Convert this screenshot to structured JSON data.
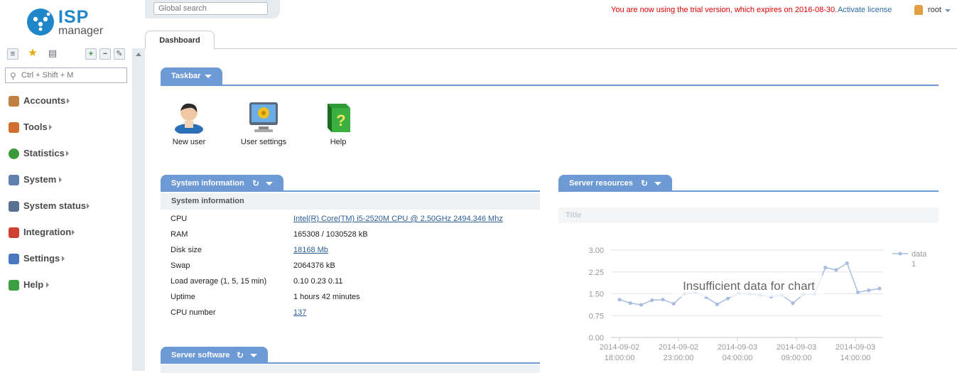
{
  "logo": {
    "word1": "ISP",
    "word2": "manager"
  },
  "nav_search": {
    "placeholder": "Ctrl + Shift + M"
  },
  "nav": [
    {
      "label": "Accounts",
      "icon": "accounts-icon",
      "color": "#c08040"
    },
    {
      "label": "Tools",
      "icon": "tools-icon",
      "color": "#d07030"
    },
    {
      "label": "Statistics",
      "icon": "statistics-icon",
      "color": "#3a9a3a"
    },
    {
      "label": "System",
      "icon": "system-icon",
      "color": "#6080b0"
    },
    {
      "label": "System status",
      "icon": "system-status-icon",
      "color": "#5a7090"
    },
    {
      "label": "Integration",
      "icon": "integration-icon",
      "color": "#d04030"
    },
    {
      "label": "Settings",
      "icon": "settings-icon",
      "color": "#4a78c0"
    },
    {
      "label": "Help",
      "icon": "help-icon",
      "color": "#3aa040"
    }
  ],
  "header": {
    "global_search_placeholder": "Global search",
    "trial_text": "You are now using the trial version, which expires on 2016-08-30.",
    "activate_label": "Activate license",
    "user": "root"
  },
  "tabs": {
    "dashboard": "Dashboard"
  },
  "taskbar": {
    "title": "Taskbar",
    "items": [
      {
        "label": "New user",
        "icon": "new-user-icon"
      },
      {
        "label": "User settings",
        "icon": "user-settings-icon"
      },
      {
        "label": "Help",
        "icon": "help-book-icon"
      }
    ]
  },
  "system_information": {
    "title": "System information",
    "subheader": "System information",
    "rows": [
      {
        "key": "CPU",
        "value": "Intel(R) Core(TM) i5-2520M CPU @ 2.50GHz 2494.346 Mhz",
        "link": true
      },
      {
        "key": "RAM",
        "value": "165308 / 1030528 kB",
        "link": false
      },
      {
        "key": "Disk size",
        "value": "18168 Mb",
        "link": true
      },
      {
        "key": "Swap",
        "value": "2064376 kB",
        "link": false
      },
      {
        "key": "Load average (1, 5, 15 min)",
        "value": "0.10 0.23 0.11",
        "link": false
      },
      {
        "key": "Uptime",
        "value": "1 hours 42 minutes",
        "link": false
      },
      {
        "key": "CPU number",
        "value": "137",
        "link": true
      }
    ]
  },
  "server_software": {
    "title": "Server software"
  },
  "server_resources": {
    "title": "Server resources",
    "chart_title": "Title",
    "overlay": "Insufficient data for chart"
  },
  "chart_data": {
    "type": "line",
    "title": "Title",
    "ylim": [
      0,
      3
    ],
    "yticks": [
      "0.00",
      "0.75",
      "1.50",
      "2.25",
      "3.00"
    ],
    "xticks": [
      [
        "2014-09-02",
        "18:00:00"
      ],
      [
        "2014-09-02",
        "23:00:00"
      ],
      [
        "2014-09-03",
        "04:00:00"
      ],
      [
        "2014-09-03",
        "09:00:00"
      ],
      [
        "2014-09-03",
        "14:00:00"
      ]
    ],
    "series": [
      {
        "name": "data",
        "legend_sub": "1",
        "color": "#a9bde0",
        "values": [
          1.3,
          1.18,
          1.12,
          1.28,
          1.3,
          1.16,
          1.5,
          1.55,
          1.38,
          1.14,
          1.34,
          1.52,
          1.5,
          1.45,
          1.4,
          1.45,
          1.18,
          1.48,
          1.5,
          2.4,
          2.32,
          2.55,
          1.55,
          1.62,
          1.68
        ]
      }
    ],
    "grid": true,
    "legend": "right"
  }
}
